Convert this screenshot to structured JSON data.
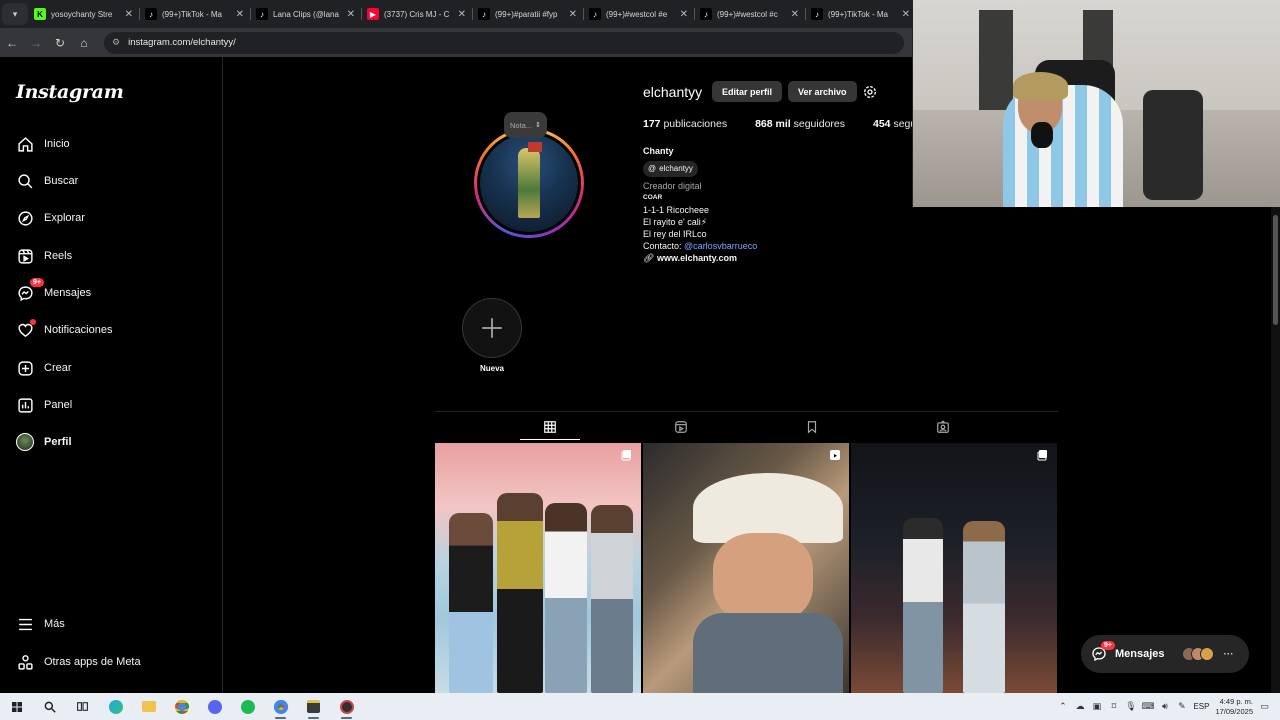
{
  "browser": {
    "tabs": [
      {
        "title": "yosoychanty Stre",
        "favicon": "K",
        "color": "#53fc18",
        "fg": "#000"
      },
      {
        "title": "(99+)TikTok - Ma",
        "favicon": "♪",
        "color": "#000",
        "fg": "#fff"
      },
      {
        "title": "Lana Clips (@lana",
        "favicon": "♪",
        "color": "#000",
        "fg": "#fff"
      },
      {
        "title": "(3737) Cris MJ - C",
        "favicon": "▶",
        "color": "#ff0033",
        "fg": "#fff"
      },
      {
        "title": "(99+)#paratii #fyp",
        "favicon": "♪",
        "color": "#000",
        "fg": "#fff"
      },
      {
        "title": "(99+)#westcol #e",
        "favicon": "♪",
        "color": "#000",
        "fg": "#fff"
      },
      {
        "title": "(99+)#westcol #c",
        "favicon": "♪",
        "color": "#000",
        "fg": "#fff"
      },
      {
        "title": "(99+)TikTok - Ma",
        "favicon": "♪",
        "color": "#000",
        "fg": "#fff"
      }
    ],
    "url": "instagram.com/elchantyy/"
  },
  "sidebar": {
    "logo": "Instagram",
    "items": [
      {
        "label": "Inicio",
        "icon": "home-icon"
      },
      {
        "label": "Buscar",
        "icon": "search-icon"
      },
      {
        "label": "Explorar",
        "icon": "compass-icon"
      },
      {
        "label": "Reels",
        "icon": "reels-icon"
      },
      {
        "label": "Mensajes",
        "icon": "messenger-icon",
        "badge": "9+"
      },
      {
        "label": "Notificaciones",
        "icon": "heart-icon"
      },
      {
        "label": "Crear",
        "icon": "plus-square-icon"
      },
      {
        "label": "Panel",
        "icon": "chart-icon"
      },
      {
        "label": "Perfil",
        "icon": "avatar-icon"
      }
    ],
    "bottom_items": [
      {
        "label": "Más",
        "icon": "menu-icon"
      },
      {
        "label": "Otras apps de Meta",
        "icon": "meta-apps-icon"
      }
    ]
  },
  "profile": {
    "note": "Nota...",
    "username": "elchantyy",
    "edit_button": "Editar perfil",
    "archive_button": "Ver archivo",
    "posts_count": "177",
    "posts_label": "publicaciones",
    "followers_count": "868 mil",
    "followers_label": "seguidores",
    "following_count": "454",
    "following_label": "seguidos",
    "name": "Chanty",
    "threads_handle": "elchantyy",
    "category": "Creador digital",
    "bio_lines": [
      "COAR",
      "1-1-1 Ricocheee",
      "El rayito e' cali⚡",
      "El rey del IRLco"
    ],
    "contact_prefix": "Contacto:",
    "contact_handle": "@carlosvbarrueco",
    "website": "www.elchanty.com",
    "highlight_new": "Nueva"
  },
  "messages_pill": {
    "label": "Mensajes",
    "badge": "9+"
  },
  "taskbar": {
    "lang": "ESP",
    "time": "4:49 p. m.",
    "date": "17/09/2025"
  }
}
